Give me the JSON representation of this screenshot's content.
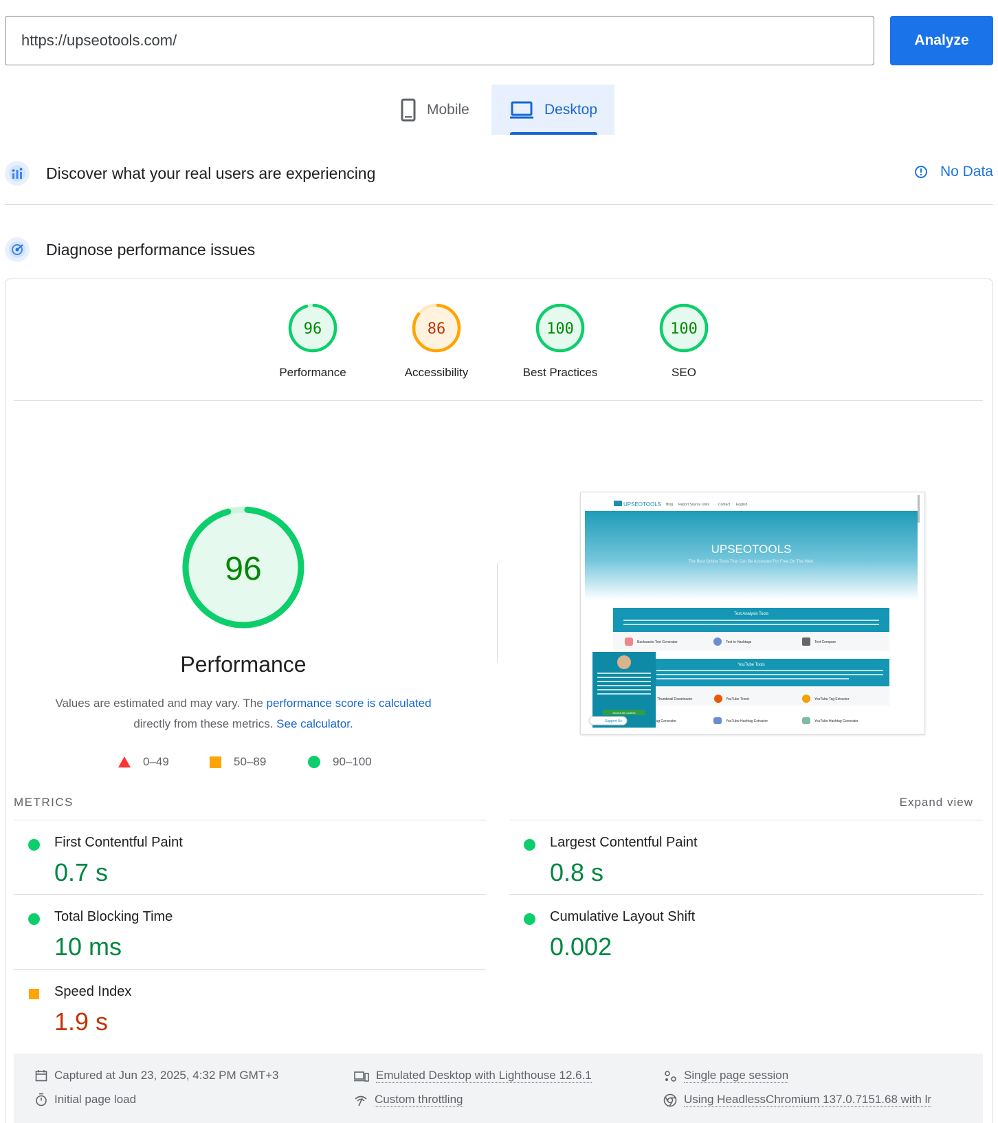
{
  "url_bar": {
    "value": "https://upseotools.com/",
    "analyze_label": "Analyze"
  },
  "tabs": [
    {
      "label": "Mobile",
      "selected": false
    },
    {
      "label": "Desktop",
      "selected": true
    }
  ],
  "field_data": {
    "title": "Discover what your real users are experiencing",
    "status": "No Data"
  },
  "lab": {
    "title": "Diagnose performance issues"
  },
  "categories": [
    {
      "label": "Performance",
      "score": "96",
      "score_value": 96,
      "rating": "good"
    },
    {
      "label": "Accessibility",
      "score": "86",
      "score_value": 86,
      "rating": "average"
    },
    {
      "label": "Best Practices",
      "score": "100",
      "score_value": 100,
      "rating": "good"
    },
    {
      "label": "SEO",
      "score": "100",
      "score_value": 100,
      "rating": "good"
    }
  ],
  "performance": {
    "score": "96",
    "score_value": 96,
    "title": "Performance",
    "desc_1": "Values are estimated and may vary. The ",
    "desc_link_1": "performance score is calculated",
    "desc_2": "directly from these metrics. ",
    "desc_link_2": "See calculator."
  },
  "legend": [
    {
      "range": "0–49",
      "shape": "triangle"
    },
    {
      "range": "50–89",
      "shape": "square"
    },
    {
      "range": "90–100",
      "shape": "circle"
    }
  ],
  "screenshot": {
    "site_logo": "UPSEOTOOLS",
    "nav": [
      "Blog",
      "Report Source Links",
      "Contact",
      "English"
    ],
    "hero_title": "UPSEOTOOLS",
    "hero_sub": "The Best Online Tools That Can Be Accessed For Free On The Web.",
    "section_1": "Text Analysis Tools",
    "section_1_desc": "Maximize abundance with our automated workflow solutions. Effortlessly addresstor ample volumes of text, automate repetitive tasks, and optimize your autograph action for efficiency. Stay focused on your creative journey while our tools handle the rest.",
    "tools_1": [
      "Backwards Text Generator",
      "Text to Hashtags",
      "Text Compare"
    ],
    "section_2": "YouTube Tools",
    "section_2_desc": "... of our complete \"YouTube Tools\" collection! Amp up your content material game with our Thumbnail Downloader, Channel Search, and unravel the mysteries of reach with our Region Restrictions Checker, and harness the electricity of analytics with our Statistics Tools. Elevate your YouTube journey comfortably!",
    "tools_2": [
      "Thumbnail Downloader",
      "YouTube Trend",
      "YouTube Tag Extractor"
    ],
    "tools_3": [
      "YouTube Tag Generator",
      "YouTube Hashtag Extractor",
      "YouTube Hashtag Generator"
    ],
    "cookie_text": "As you explore our website and associated media, we employ cookies and tracking technologies to tailor the site and enhance your browsing experience. For additional details, kindly refer to the COOKIE POLICY page.",
    "cookie_btn": "Accept All Cookies",
    "support": "Support Us"
  },
  "metrics": {
    "heading": "METRICS",
    "expand": "Expand view",
    "items": [
      {
        "name": "First Contentful Paint",
        "value": "0.7 s",
        "rating": "good"
      },
      {
        "name": "Largest Contentful Paint",
        "value": "0.8 s",
        "rating": "good"
      },
      {
        "name": "Total Blocking Time",
        "value": "10 ms",
        "rating": "good"
      },
      {
        "name": "Cumulative Layout Shift",
        "value": "0.002",
        "rating": "good"
      },
      {
        "name": "Speed Index",
        "value": "1.9 s",
        "rating": "average"
      }
    ]
  },
  "runtime": {
    "captured": "Captured at Jun 23, 2025, 4:32 PM GMT+3",
    "emulated": "Emulated Desktop with Lighthouse 12.6.1",
    "session": "Single page session",
    "load": "Initial page load",
    "throttling": "Custom throttling",
    "browser": "Using HeadlessChromium 137.0.7151.68 with lr"
  },
  "colors": {
    "accent": "#1a73e8",
    "pass": "#0cce6b",
    "pass_text": "#008800",
    "average": "#ffa400",
    "average_text": "#c33300",
    "fail": "#ff3333"
  }
}
